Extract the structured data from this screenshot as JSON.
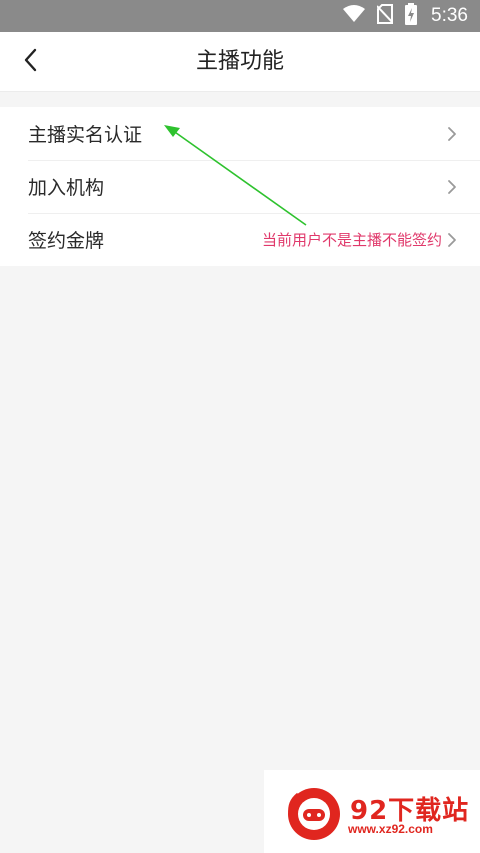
{
  "status_bar": {
    "time": "5:36",
    "icons": [
      "wifi-icon",
      "no-sim-icon",
      "battery-charging-icon"
    ]
  },
  "header": {
    "title": "主播功能",
    "back_icon": "chevron-left-icon"
  },
  "menu": {
    "items": [
      {
        "label": "主播实名认证",
        "note": ""
      },
      {
        "label": "加入机构",
        "note": ""
      },
      {
        "label": "签约金牌",
        "note": "当前用户不是主播不能签约"
      }
    ]
  },
  "annotation": {
    "color": "#2ec22e"
  },
  "watermark": {
    "name": "92下载站",
    "url": "www.xz92.com",
    "color": "#e0261f"
  },
  "colors": {
    "status_bar": "#8a8a8a",
    "background": "#f5f5f5",
    "note_text": "#e0396b"
  }
}
